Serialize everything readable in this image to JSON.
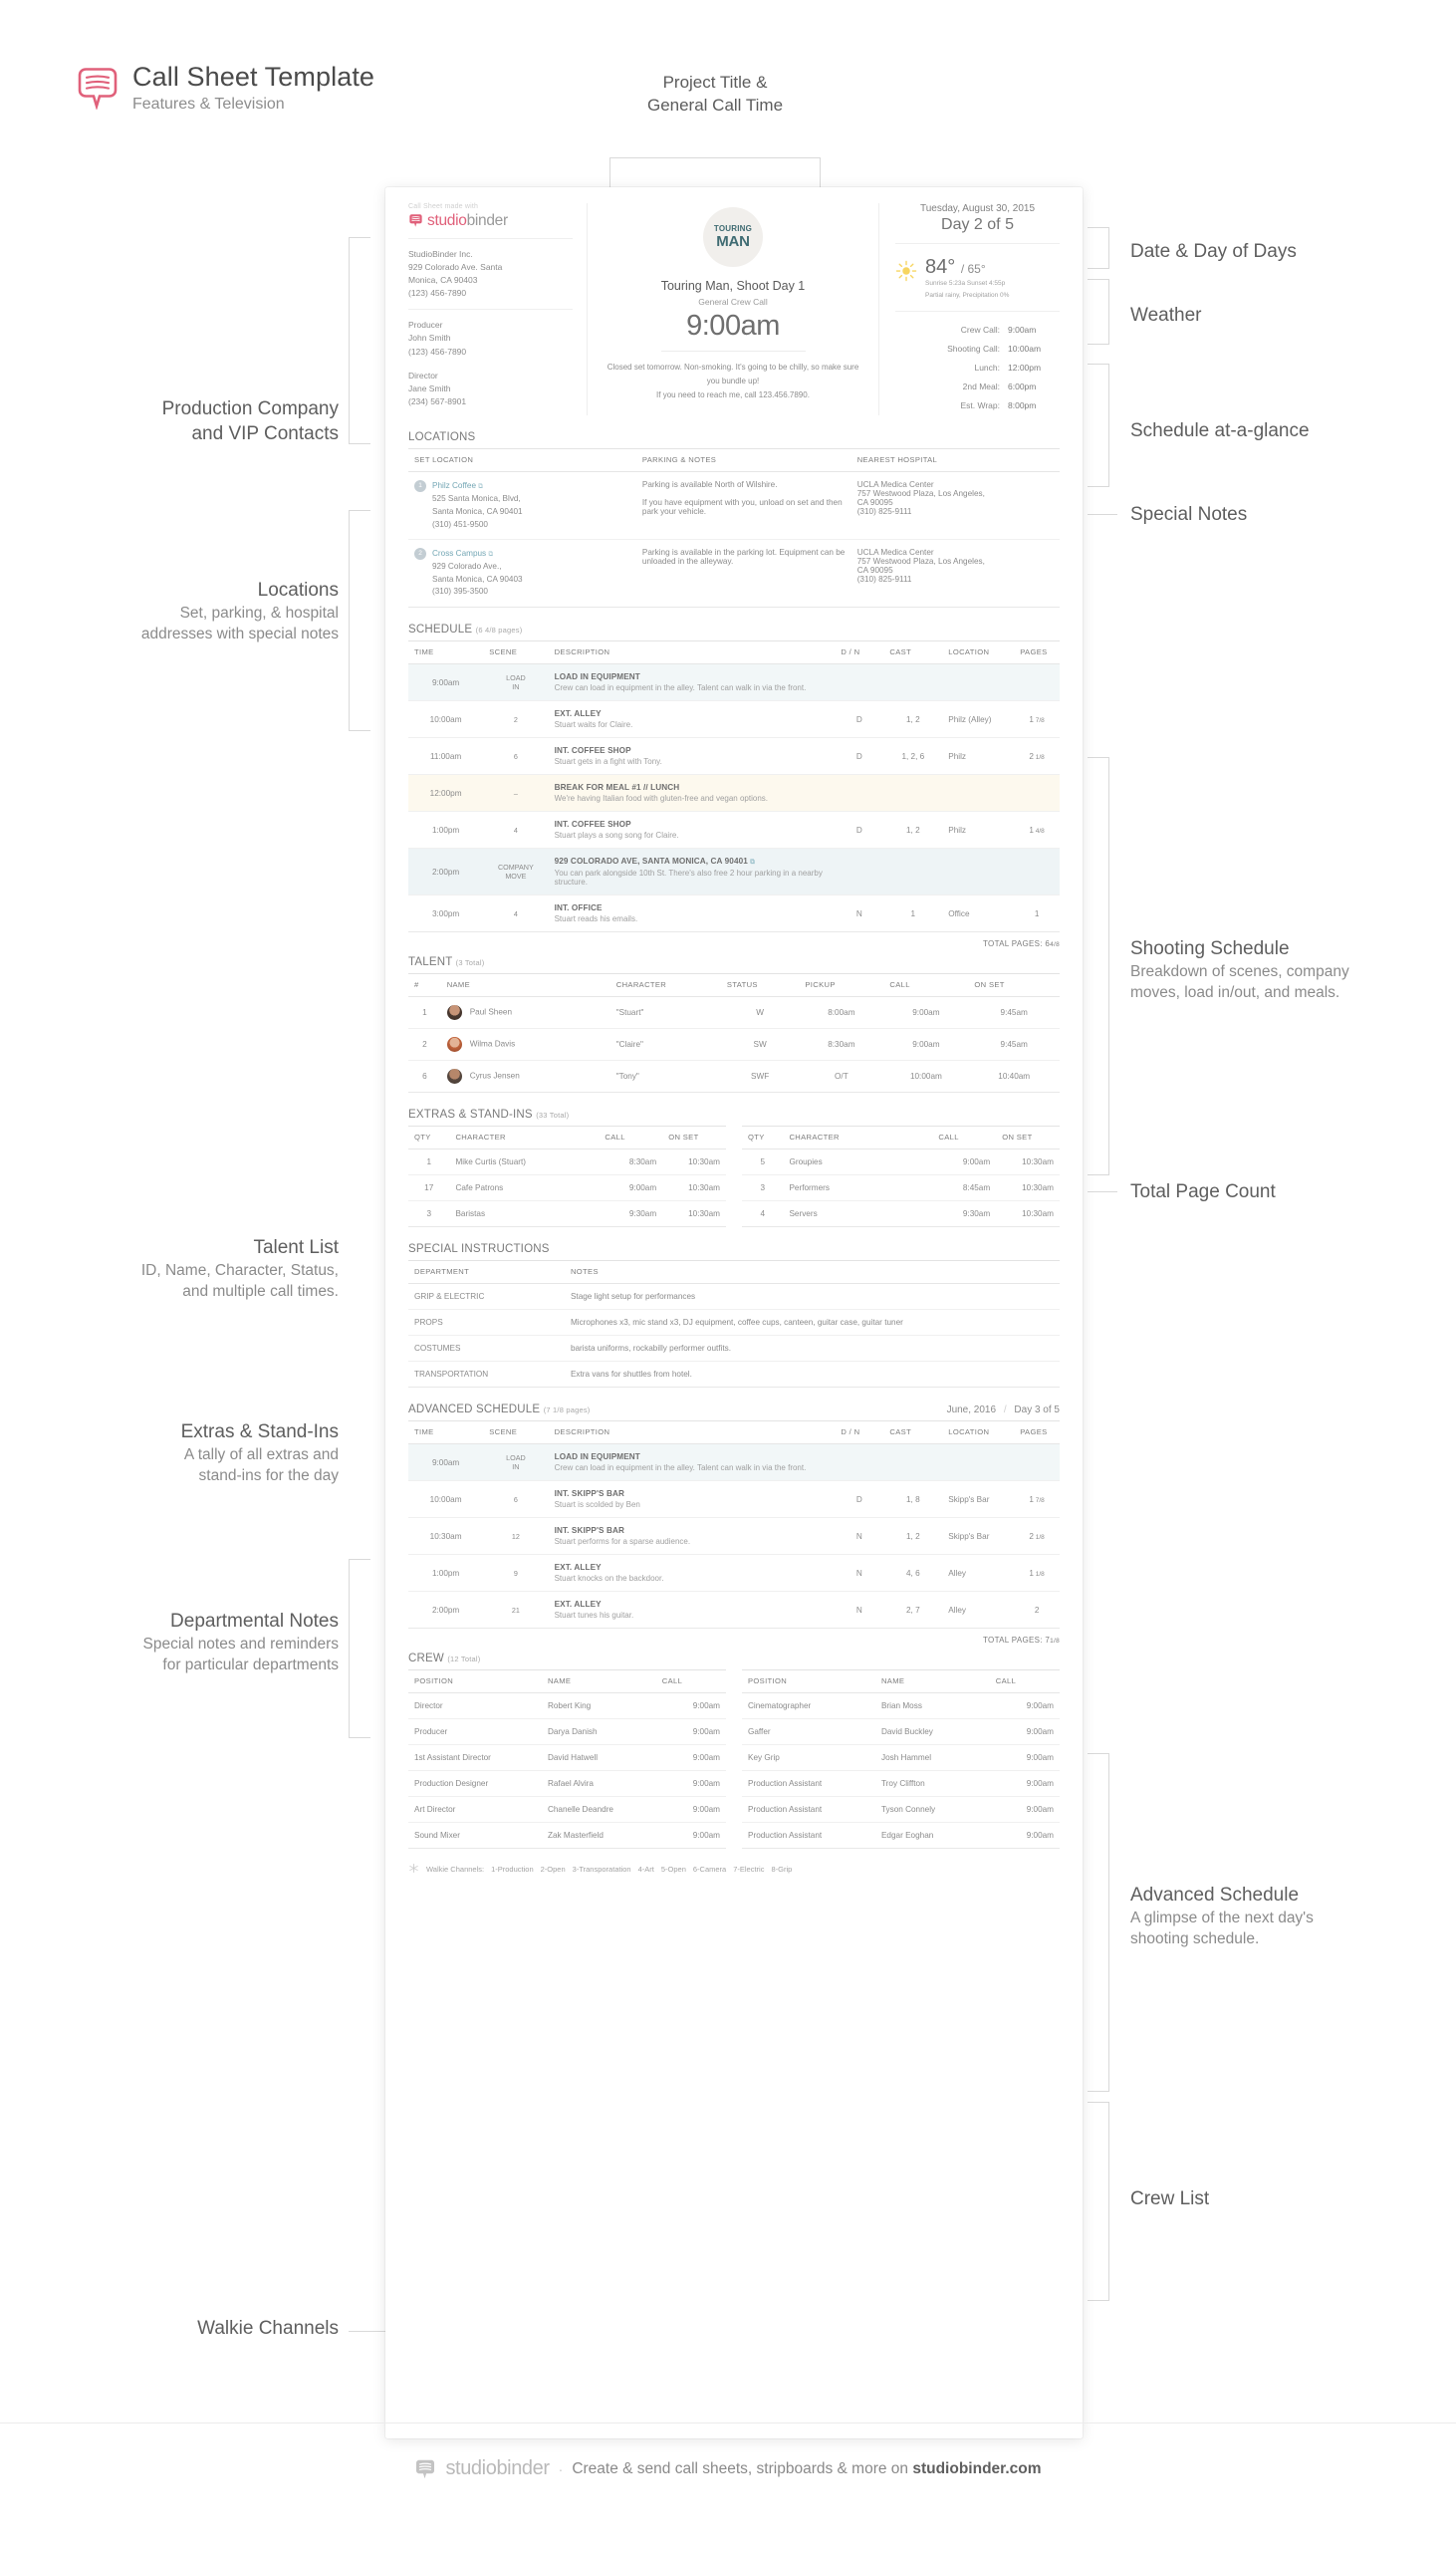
{
  "header": {
    "title": "Call Sheet Template",
    "subtitle": "Features & Television",
    "logo_icon": "studiobinder-speech-bubble-icon",
    "project_callout": "Project Title &\nGeneral Call Time"
  },
  "annotations": {
    "left": [
      {
        "title": "Production Company",
        "title2": "and VIP Contacts",
        "sub": ""
      },
      {
        "title": "Locations",
        "sub": "Set, parking, & hospital\naddresses with special notes"
      },
      {
        "title": "Talent List",
        "sub": "ID, Name, Character, Status,\nand multiple call times."
      },
      {
        "title": "Extras & Stand-Ins",
        "sub": "A tally of all extras and\nstand-ins for the day"
      },
      {
        "title": "Departmental Notes",
        "sub": "Special notes and reminders\nfor particular departments"
      },
      {
        "title": "Walkie Channels",
        "sub": ""
      }
    ],
    "right": [
      {
        "title": "Date & Day of Days",
        "sub": ""
      },
      {
        "title": "Weather",
        "sub": ""
      },
      {
        "title": "Schedule at-a-glance",
        "sub": ""
      },
      {
        "title": "Special Notes",
        "sub": ""
      },
      {
        "title": "Shooting Schedule",
        "sub": "Breakdown of scenes, company\nmoves, load in/out, and meals."
      },
      {
        "title": "Total Page Count",
        "sub": ""
      },
      {
        "title": "Advanced Schedule",
        "sub": "A glimpse of the next day's\nshooting schedule."
      },
      {
        "title": "Crew List",
        "sub": ""
      }
    ]
  },
  "sheet": {
    "made_with": "Call Sheet made with",
    "brand_word_a": "studio",
    "brand_word_b": "binder",
    "company": {
      "name": "StudioBinder Inc.",
      "address1": "929 Colorado Ave. Santa",
      "address2": "Monica, CA 90403",
      "phone": "(123) 456-7890"
    },
    "contacts": [
      {
        "role": "Producer",
        "name": "John Smith",
        "phone": "(123) 456-7890"
      },
      {
        "role": "Director",
        "name": "Jane Smith",
        "phone": "(234) 567-8901"
      }
    ],
    "poster": {
      "line1": "TOURING",
      "line2": "MAN",
      "icon": "airplane-icon"
    },
    "shoot_title": "Touring Man, Shoot Day 1",
    "general_call_label": "General Crew Call",
    "general_call_time": "9:00am",
    "special_notes": "Closed set tomorrow. Non-smoking. It's going to be chilly, so make sure you bundle up!\nIf you need to reach me, call 123.456.7890.",
    "date": "Tuesday, August 30, 2015",
    "day_of_days": "Day 2 of 5",
    "weather": {
      "icon": "sun-icon",
      "high": "84°",
      "low": "/ 65°",
      "sun": "Sunrise 5:23a  Sunset 4:55p",
      "conditions": "Partial rainy, Precipitation 0%"
    },
    "schedule_glance": [
      {
        "label": "Crew Call:",
        "value": "9:00am"
      },
      {
        "label": "Shooting Call:",
        "value": "10:00am"
      },
      {
        "label": "Lunch:",
        "value": "12:00pm"
      },
      {
        "label": "2nd Meal:",
        "value": "6:00pm"
      },
      {
        "label": "Est. Wrap:",
        "value": "8:00pm"
      }
    ],
    "locations": {
      "title": "LOCATIONS",
      "headers": [
        "SET LOCATION",
        "PARKING & NOTES",
        "NEAREST HOSPITAL"
      ],
      "rows": [
        {
          "num": "1",
          "link": "Philz Coffee",
          "addr": "525 Santa Monica, Blvd,\nSanta Monica, CA 90401\n(310) 451-9500",
          "parking": "Parking is available North of Wilshire.\n\nIf you have equipment with you, unload on set and then park your vehicle.",
          "hospital": "UCLA Medica Center\n757 Westwood Plaza, Los Angeles,\nCA 90095\n(310) 825-9111"
        },
        {
          "num": "2",
          "link": "Cross Campus",
          "addr": "929 Colorado Ave.,\nSanta Monica, CA 90403\n(310) 395-3500",
          "parking": "Parking is available in the parking lot. Equipment can be unloaded in the alleyway.",
          "hospital": "UCLA Medica Center\n757 Westwood Plaza, Los Angeles,\nCA 90095\n(310) 825-9111"
        }
      ]
    },
    "schedule": {
      "title": "SCHEDULE",
      "count": "(6 4/8 pages)",
      "headers": [
        "TIME",
        "SCENE",
        "DESCRIPTION",
        "D / N",
        "CAST",
        "LOCATION",
        "PAGES"
      ],
      "rows": [
        {
          "kind": "loadin",
          "time": "9:00am",
          "scene": "LOAD\nIN",
          "title": "LOAD IN EQUIPMENT",
          "sub": "Crew can load in equipment in the alley. Talent can walk in via the front.",
          "dn": "",
          "cast": "",
          "location": "",
          "pages": "",
          "frac": ""
        },
        {
          "kind": "normal",
          "time": "10:00am",
          "scene": "2",
          "title": "EXT. ALLEY",
          "sub": "Stuart waits for Claire.",
          "dn": "D",
          "cast": "1, 2",
          "location": "Philz (Alley)",
          "pages": "1",
          "frac": "7/8"
        },
        {
          "kind": "normal",
          "time": "11:00am",
          "scene": "6",
          "title": "INT. COFFEE SHOP",
          "sub": "Stuart gets in a fight with Tony.",
          "dn": "D",
          "cast": "1, 2, 6",
          "location": "Philz",
          "pages": "2",
          "frac": "1/8"
        },
        {
          "kind": "meal",
          "time": "12:00pm",
          "scene": "–",
          "title": "BREAK FOR MEAL #1 // LUNCH",
          "sub": "We're having Italian food with gluten-free and vegan options.",
          "dn": "",
          "cast": "",
          "location": "",
          "pages": "",
          "frac": ""
        },
        {
          "kind": "normal",
          "time": "1:00pm",
          "scene": "4",
          "title": "INT. COFFEE SHOP",
          "sub": "Stuart plays a song song for Claire.",
          "dn": "D",
          "cast": "1, 2",
          "location": "Philz",
          "pages": "1",
          "frac": "4/8"
        },
        {
          "kind": "move",
          "time": "2:00pm",
          "scene": "COMPANY\nMOVE",
          "title": "929 COLORADO AVE, SANTA MONICA, CA 90401",
          "sub": "You can park alongside 10th St. There's also free 2 hour parking in a nearby structure.",
          "dn": "",
          "cast": "",
          "location": "",
          "pages": "",
          "frac": ""
        },
        {
          "kind": "normal",
          "time": "3:00pm",
          "scene": "4",
          "title": "INT. OFFICE",
          "sub": "Stuart reads his emails.",
          "dn": "N",
          "cast": "1",
          "location": "Office",
          "pages": "1",
          "frac": ""
        }
      ],
      "total_label": "TOTAL PAGES:",
      "total_value": "6",
      "total_frac": "4/8"
    },
    "talent": {
      "title": "TALENT",
      "count": "(3 Total)",
      "headers": [
        "#",
        "NAME",
        "CHARACTER",
        "STATUS",
        "PICKUP",
        "CALL",
        "ON SET"
      ],
      "rows": [
        {
          "id": "1",
          "name": "Paul Sheen",
          "character": "\"Stuart\"",
          "status": "W",
          "pickup": "8:00am",
          "call": "9:00am",
          "onset": "9:45am"
        },
        {
          "id": "2",
          "name": "Wilma Davis",
          "character": "\"Claire\"",
          "status": "SW",
          "pickup": "8:30am",
          "call": "9:00am",
          "onset": "9:45am"
        },
        {
          "id": "6",
          "name": "Cyrus Jensen",
          "character": "\"Tony\"",
          "status": "SWF",
          "pickup": "O/T",
          "call": "10:00am",
          "onset": "10:40am"
        }
      ]
    },
    "extras": {
      "title": "EXTRAS & STAND-INS",
      "count": "(33 Total)",
      "headers": [
        "QTY",
        "CHARACTER",
        "CALL",
        "ON SET"
      ],
      "left_rows": [
        {
          "qty": "1",
          "character": "Mike Curtis (Stuart)",
          "call": "8:30am",
          "onset": "10:30am"
        },
        {
          "qty": "17",
          "character": "Cafe Patrons",
          "call": "9:00am",
          "onset": "10:30am"
        },
        {
          "qty": "3",
          "character": "Baristas",
          "call": "9:30am",
          "onset": "10:30am"
        }
      ],
      "right_rows": [
        {
          "qty": "5",
          "character": "Groupies",
          "call": "9:00am",
          "onset": "10:30am"
        },
        {
          "qty": "3",
          "character": "Performers",
          "call": "8:45am",
          "onset": "10:30am"
        },
        {
          "qty": "4",
          "character": "Servers",
          "call": "9:30am",
          "onset": "10:30am"
        }
      ]
    },
    "special_instructions": {
      "title": "SPECIAL INSTRUCTIONS",
      "headers": [
        "DEPARTMENT",
        "NOTES"
      ],
      "rows": [
        {
          "dept": "GRIP & ELECTRIC",
          "note": "Stage light setup for performances"
        },
        {
          "dept": "PROPS",
          "note": "Microphones x3, mic stand x3, DJ equipment, coffee cups, canteen, guitar case, guitar tuner"
        },
        {
          "dept": "COSTUMES",
          "note": "barista uniforms, rockabilly performer outfits."
        },
        {
          "dept": "TRANSPORTATION",
          "note": "Extra vans for shuttles from hotel."
        }
      ]
    },
    "advanced": {
      "title": "ADVANCED SCHEDULE",
      "count": "(7 1/8 pages)",
      "date": "June, 2016",
      "day_of_days": "Day 3 of 5",
      "headers": [
        "TIME",
        "SCENE",
        "DESCRIPTION",
        "D / N",
        "CAST",
        "LOCATION",
        "PAGES"
      ],
      "rows": [
        {
          "kind": "loadin",
          "time": "9:00am",
          "scene": "LOAD\nIN",
          "title": "LOAD IN EQUIPMENT",
          "sub": "Crew can load in equipment in the alley. Talent can walk in via the front.",
          "dn": "",
          "cast": "",
          "location": "",
          "pages": "",
          "frac": ""
        },
        {
          "kind": "normal",
          "time": "10:00am",
          "scene": "6",
          "title": "INT. SKIPP'S BAR",
          "sub": "Stuart is scolded by Ben",
          "dn": "D",
          "cast": "1, 8",
          "location": "Skipp's Bar",
          "pages": "1",
          "frac": "7/8"
        },
        {
          "kind": "normal",
          "time": "10:30am",
          "scene": "12",
          "title": "INT. SKIPP'S BAR",
          "sub": "Stuart performs for a sparse audience.",
          "dn": "N",
          "cast": "1, 2",
          "location": "Skipp's Bar",
          "pages": "2",
          "frac": "1/8"
        },
        {
          "kind": "normal",
          "time": "1:00pm",
          "scene": "9",
          "title": "EXT. ALLEY",
          "sub": "Stuart knocks on the backdoor.",
          "dn": "N",
          "cast": "4, 6",
          "location": "Alley",
          "pages": "1",
          "frac": "1/8"
        },
        {
          "kind": "normal",
          "time": "2:00pm",
          "scene": "21",
          "title": "EXT. ALLEY",
          "sub": "Stuart tunes his guitar.",
          "dn": "N",
          "cast": "2, 7",
          "location": "Alley",
          "pages": "2",
          "frac": ""
        }
      ],
      "total_label": "TOTAL PAGES:",
      "total_value": "7",
      "total_frac": "1/8"
    },
    "crew": {
      "title": "CREW",
      "count": "(12 Total)",
      "headers": [
        "POSITION",
        "NAME",
        "CALL"
      ],
      "left_rows": [
        {
          "position": "Director",
          "name": "Robert King",
          "call": "9:00am"
        },
        {
          "position": "Producer",
          "name": "Darya Danish",
          "call": "9:00am"
        },
        {
          "position": "1st Assistant Director",
          "name": "David Hatwell",
          "call": "9:00am"
        },
        {
          "position": "Production Designer",
          "name": "Rafael Alvira",
          "call": "9:00am"
        },
        {
          "position": "Art Director",
          "name": "Chanelle Deandre",
          "call": "9:00am"
        },
        {
          "position": "Sound Mixer",
          "name": "Zak Masterfield",
          "call": "9:00am"
        }
      ],
      "right_rows": [
        {
          "position": "Cinematographer",
          "name": "Brian Moss",
          "call": "9:00am"
        },
        {
          "position": "Gaffer",
          "name": "David Buckley",
          "call": "9:00am"
        },
        {
          "position": "Key Grip",
          "name": "Josh Hammel",
          "call": "9:00am"
        },
        {
          "position": "Production Assistant",
          "name": "Troy Cliffton",
          "call": "9:00am"
        },
        {
          "position": "Production Assistant",
          "name": "Tyson Connely",
          "call": "9:00am"
        },
        {
          "position": "Production Assistant",
          "name": "Edgar Eoghan",
          "call": "9:00am"
        }
      ]
    },
    "walkie": {
      "icon": "asterisk-icon",
      "label": "Walkie Channels:",
      "channels": [
        "1-Production",
        "2-Open",
        "3-Transporatation",
        "4-Art",
        "5-Open",
        "6-Camera",
        "7-Electric",
        "8-Grip"
      ]
    }
  },
  "footer": {
    "brand_a": "studio",
    "brand_b": "binder",
    "dot": "·",
    "text_pre": "Create & send call sheets, stripboards & more on ",
    "text_bold": "studiobinder.com"
  },
  "colors": {
    "brand_pink": "#e0607a",
    "link_blue": "#74a7b5",
    "loadin_bg": "#f2f7f8",
    "meal_bg": "#fdf9ee",
    "move_bg": "#eef4f6"
  }
}
